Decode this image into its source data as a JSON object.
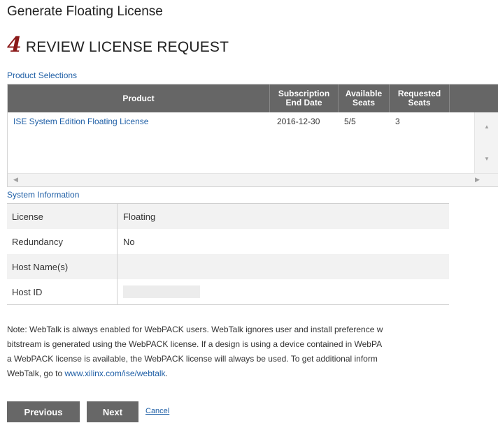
{
  "page": {
    "title": "Generate Floating License",
    "step_number": "4",
    "step_title": "REVIEW LICENSE REQUEST"
  },
  "product_selections": {
    "label": "Product Selections",
    "columns": {
      "product": "Product",
      "subscription_end_date_line1": "Subscription",
      "subscription_end_date_line2": "End Date",
      "available_seats_line1": "Available",
      "available_seats_line2": "Seats",
      "requested_seats_line1": "Requested",
      "requested_seats_line2": "Seats"
    },
    "rows": [
      {
        "product": "ISE System Edition Floating License",
        "end_date": "2016-12-30",
        "available_seats": "5/5",
        "requested_seats": "3"
      }
    ]
  },
  "system_information": {
    "label": "System Information",
    "rows": [
      {
        "key": "License",
        "value": "Floating"
      },
      {
        "key": "Redundancy",
        "value": "No"
      },
      {
        "key": "Host Name(s)",
        "value": ""
      },
      {
        "key": "Host ID",
        "value": ""
      }
    ]
  },
  "note": {
    "line1": "Note: WebTalk is always enabled for WebPACK users. WebTalk ignores user and install preference w",
    "line2": "bitstream is generated using the WebPACK license. If a design is using a device contained in WebPA",
    "line3": "a WebPACK license is available, the WebPACK license will always be used. To get additional inform",
    "line4_prefix": "WebTalk, go to ",
    "link_text": "www.xilinx.com/ise/webtalk",
    "line4_suffix": "."
  },
  "buttons": {
    "previous": "Previous",
    "next": "Next",
    "cancel": "Cancel"
  },
  "colors": {
    "header_bg": "#666666",
    "link": "#1f5fa6",
    "step_number": "#8b1a1a",
    "button_bg": "#676767"
  }
}
